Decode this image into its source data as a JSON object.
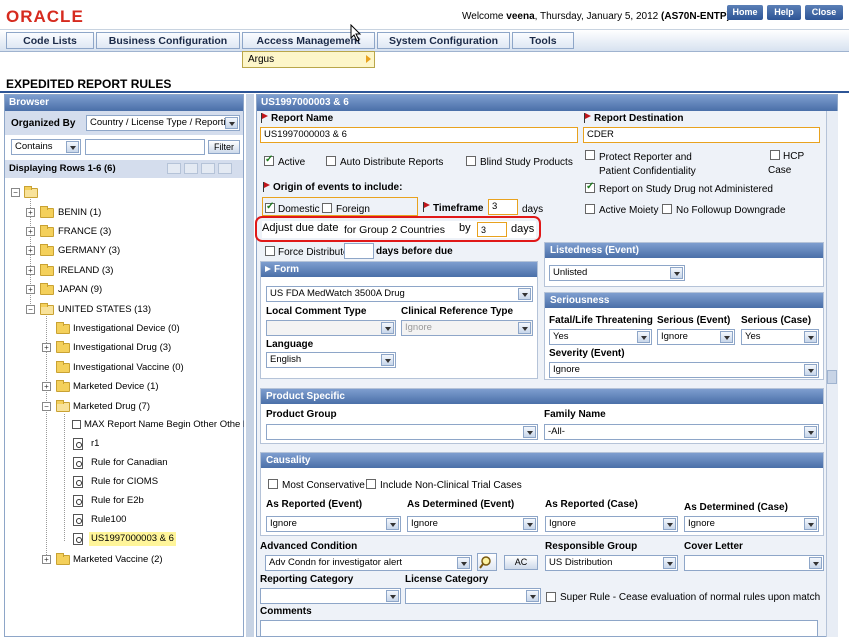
{
  "header": {
    "logo": "ORACLE",
    "welcome_prefix": "Welcome",
    "user": "veena",
    "date_text": ", Thursday, January 5, 2012",
    "server": "(AS70N-ENTP)",
    "buttons": [
      "Home",
      "Help",
      "Close"
    ]
  },
  "menu": {
    "items": [
      "Code Lists",
      "Business Configuration",
      "Access Management",
      "System Configuration",
      "Tools"
    ],
    "submenu_item": "Argus"
  },
  "page_title": "EXPEDITED REPORT RULES",
  "browser": {
    "title": "Browser",
    "organized_by_label": "Organized By",
    "organized_by_value": "Country / License Type / Reportin",
    "match_value": "Contains",
    "filter_button": "Filter",
    "rows_text": "Displaying Rows 1-6 (6)",
    "tree": {
      "countries": [
        "BENIN (1)",
        "FRANCE (3)",
        "GERMANY (3)",
        "IRELAND (3)",
        "JAPAN (9)",
        "UNITED STATES (13)"
      ],
      "us_children": [
        "Investigational Device (0)",
        "Investigational Drug (3)",
        "Investigational Vaccine (0)",
        "Marketed Device (1)",
        "Marketed Drug (7)"
      ],
      "drug_rules": [
        "MAX Report Name Begin Other Othe End",
        "r1",
        "Rule for Canadian",
        "Rule for CIOMS",
        "Rule for E2b",
        "Rule100",
        "US1997000003 & 6"
      ],
      "last_child": "Marketed Vaccine (2)"
    }
  },
  "form": {
    "title": "US1997000003 & 6",
    "report_name_label": "Report Name",
    "report_name_value": "US1997000003 & 6",
    "report_destination_label": "Report Destination",
    "report_destination_value": "CDER",
    "active_label": "Active",
    "auto_distribute_label": "Auto Distribute Reports",
    "blind_study_label": "Blind Study Products",
    "protect_reporter_label": "Protect Reporter and Patient Confidentiality",
    "hcp_label": "HCP",
    "case_label": "Case",
    "origin_label": "Origin of events to include:",
    "domestic_label": "Domestic",
    "foreign_label": "Foreign",
    "timeframe_label": "Timeframe",
    "timeframe_value": "3",
    "days_label": "days",
    "report_on_study_label": "Report on Study Drug not Administered",
    "active_moiety_label": "Active Moiety",
    "no_followup_label": "No Followup Downgrade",
    "adjust_prefix": "Adjust due date",
    "adjust_group": "for Group 2 Countries",
    "adjust_by": "by",
    "adjust_value": "3",
    "adjust_days": "days",
    "force_distribute_label": "Force Distribute",
    "days_before_due_label": "days before due",
    "form_section_label": "Form",
    "form_value": "US FDA MedWatch 3500A Drug",
    "local_comment_label": "Local Comment Type",
    "clinical_ref_label": "Clinical Reference Type",
    "clinical_ref_value": "Ignore",
    "language_label": "Language",
    "language_value": "English",
    "listedness_label": "Listedness (Event)",
    "listedness_value": "Unlisted",
    "seriousness_label": "Seriousness",
    "fatal_label": "Fatal/Life Threatening",
    "fatal_value": "Yes",
    "serious_event_label": "Serious (Event)",
    "serious_event_value": "Ignore",
    "serious_case_label": "Serious (Case)",
    "serious_case_value": "Yes",
    "severity_label": "Severity (Event)",
    "severity_value": "Ignore",
    "product_specific_label": "Product Specific",
    "product_group_label": "Product Group",
    "family_name_label": "Family Name",
    "family_name_value": "-All-",
    "causality_label": "Causality",
    "most_conservative_label": "Most Conservative",
    "include_nonclinical_label": "Include Non-Clinical Trial Cases",
    "as_reported_event_label": "As Reported (Event)",
    "as_determined_event_label": "As Determined (Event)",
    "as_reported_case_label": "As Reported (Case)",
    "as_determined_case_label": "As Determined (Case)",
    "ignore_value": "Ignore",
    "advanced_condition_label": "Advanced Condition",
    "advanced_condition_value": "Adv Condn for investigator alert",
    "ac_button": "AC",
    "responsible_group_label": "Responsible Group",
    "responsible_group_value": "US Distribution",
    "cover_letter_label": "Cover Letter",
    "reporting_category_label": "Reporting Category",
    "license_category_label": "License Category",
    "super_rule_label": "Super Rule - Cease evaluation of normal rules upon match",
    "comments_label": "Comments"
  },
  "colors": {
    "accent": "#2d5596",
    "oracle_red": "#d62b1f",
    "highlight_ring": "#e01818",
    "selected_node": "#fff59a"
  }
}
